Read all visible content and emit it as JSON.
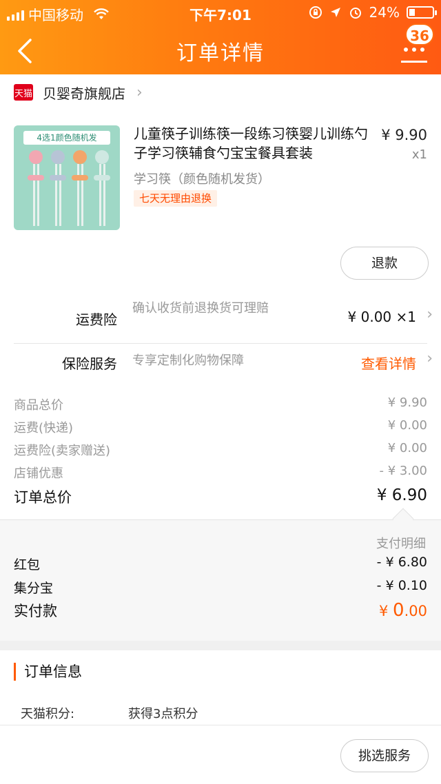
{
  "status_bar": {
    "carrier": "中国移动",
    "time": "下午7:01",
    "battery": "24%",
    "battery_level": 0.24
  },
  "header": {
    "title": "订单详情",
    "badge": "36"
  },
  "shop": {
    "name": "贝婴奇旗舰店",
    "logo_text": "天猫"
  },
  "product": {
    "image_banner": "4选1颜色随机发",
    "title": "儿童筷子训练筷一段练习筷婴儿训练勺子学习筷辅食勺宝宝餐具套装",
    "spec": "学习筷（颜色随机发货）",
    "tag": "七天无理由退换",
    "price": "¥ 9.90",
    "qty": "x1",
    "refund_button": "退款"
  },
  "services": [
    {
      "label": "运费险",
      "desc": "确认收货前退换货可理赔",
      "value": "¥ 0.00 ×1"
    },
    {
      "label": "保险服务",
      "desc": "专享定制化购物保障",
      "value": "查看详情"
    }
  ],
  "price_summary": [
    {
      "label": "商品总价",
      "value": "¥ 9.90"
    },
    {
      "label": "运费(快递)",
      "value": "¥ 0.00"
    },
    {
      "label": "运费险(卖家赠送)",
      "value": "¥ 0.00"
    },
    {
      "label": "店铺优惠",
      "value": "- ¥ 3.00"
    }
  ],
  "order_total": {
    "label": "订单总价",
    "value": "¥ 6.90"
  },
  "payment": {
    "title": "支付明细",
    "rows": [
      {
        "label": "红包",
        "value": "- ¥ 6.80"
      },
      {
        "label": "集分宝",
        "value": "- ¥ 0.10"
      }
    ],
    "final": {
      "label": "实付款",
      "currency": "¥ ",
      "value_int": "0",
      "value_dec": ".00"
    }
  },
  "order_info": {
    "title": "订单信息",
    "rows": [
      {
        "key": "天猫积分:",
        "value": "获得3点积分"
      }
    ]
  },
  "bottom": {
    "button": "挑选服务"
  },
  "colors": {
    "header_start": "#ff9a12",
    "header_end": "#ff5a12",
    "accent": "#ff5a00",
    "tmall_red": "#e0001b"
  }
}
